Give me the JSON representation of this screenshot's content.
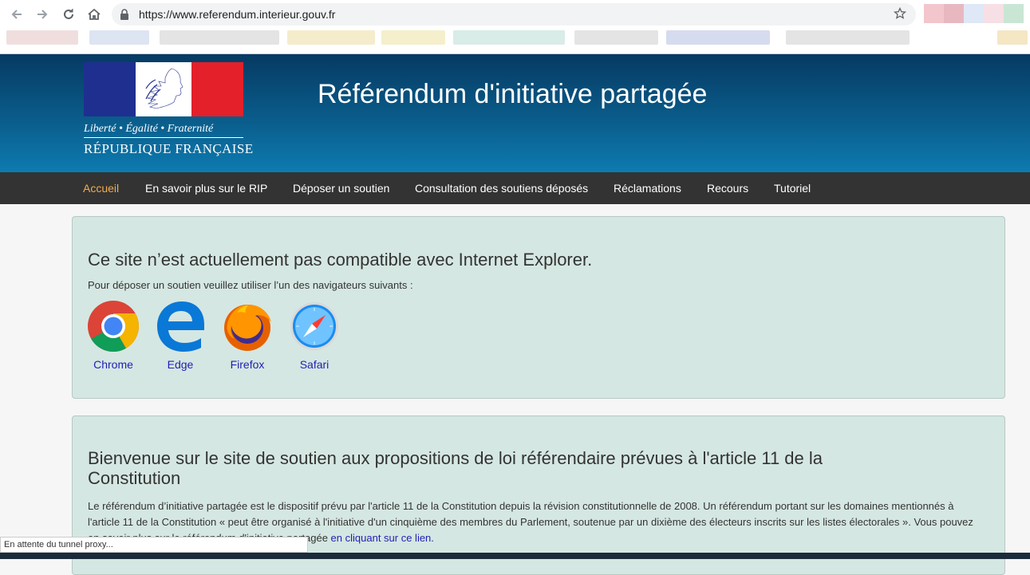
{
  "browser": {
    "url": "https://www.referendum.interieur.gouv.fr",
    "icons": [
      "back-icon",
      "forward-icon",
      "reload-icon",
      "home-icon",
      "lock-icon",
      "star-icon"
    ]
  },
  "header": {
    "motto": "Liberté • Égalité • Fraternité",
    "republic": "RÉPUBLIQUE FRANÇAISE",
    "title": "Référendum d'initiative partagée",
    "colors": {
      "gradient_top": "#063a63",
      "gradient_bottom": "#0d7bb0",
      "flag_blue": "#1f2f8f",
      "flag_red": "#e4202a"
    }
  },
  "nav": {
    "items": [
      {
        "label": "Accueil",
        "active": true
      },
      {
        "label": "En savoir plus sur le RIP",
        "active": false
      },
      {
        "label": "Déposer un soutien",
        "active": false
      },
      {
        "label": "Consultation des soutiens déposés",
        "active": false
      },
      {
        "label": "Réclamations",
        "active": false
      },
      {
        "label": "Recours",
        "active": false
      },
      {
        "label": "Tutoriel",
        "active": false
      }
    ],
    "active_color": "#f0ad4e"
  },
  "compat": {
    "title": "Ce site n’est actuellement pas compatible avec Internet Explorer.",
    "subtitle": "Pour déposer un soutien veuillez utiliser l’un des navigateurs suivants :",
    "browsers": [
      {
        "name": "Chrome",
        "icon": "chrome-icon"
      },
      {
        "name": "Edge",
        "icon": "edge-icon"
      },
      {
        "name": "Firefox",
        "icon": "firefox-icon"
      },
      {
        "name": "Safari",
        "icon": "safari-icon"
      }
    ]
  },
  "welcome": {
    "title": "Bienvenue sur le site de soutien aux propositions de loi référendaire prévues à l'article 11 de la Constitution",
    "body": "Le référendum d’initiative partagée est le dispositif prévu par l'article 11 de la Constitution depuis la révision constitutionnelle de 2008. Un référendum portant sur les domaines mentionnés à l'article 11 de la Constitution « peut être organisé à l'initiative d'un cinquième des membres du Parlement, soutenue par un dixième des électeurs inscrits sur les listes électorales ». Vous pouvez en savoir plus sur le référendum d'initiative partagée ",
    "link": "en cliquant sur ce lien."
  },
  "status_bar": "En attente du tunnel proxy..."
}
